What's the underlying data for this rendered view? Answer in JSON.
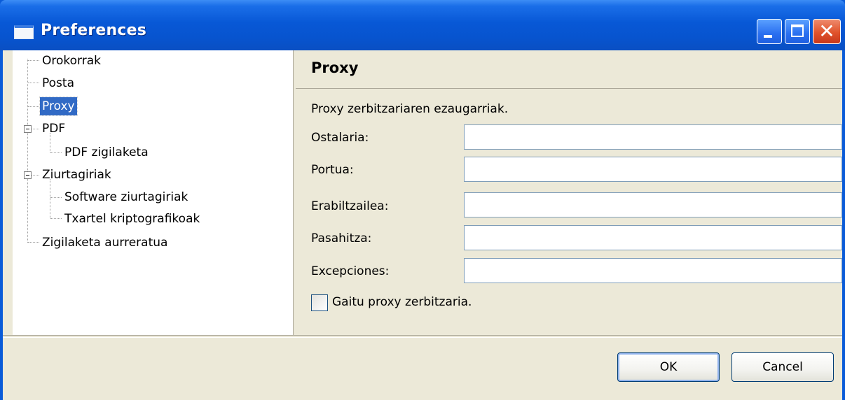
{
  "window": {
    "title": "Preferences"
  },
  "title_buttons": {
    "minimize_icon": "minimize-icon",
    "maximize_icon": "maximize-icon",
    "close_glyph": "✕"
  },
  "tree": {
    "items": [
      {
        "label": "Orokorrak"
      },
      {
        "label": "Posta"
      },
      {
        "label": "Proxy",
        "selected": true
      },
      {
        "label": "PDF",
        "expanded": true
      },
      {
        "label": "PDF zigilaketa"
      },
      {
        "label": "Ziurtagiriak",
        "expanded": true
      },
      {
        "label": "Software ziurtagiriak"
      },
      {
        "label": "Txartel kriptografikoak"
      },
      {
        "label": "Zigilaketa aurreratua"
      }
    ]
  },
  "panel": {
    "title": "Proxy",
    "description": "Proxy zerbitzariaren ezaugarriak.",
    "fields": [
      {
        "label": "Ostalaria:",
        "value": ""
      },
      {
        "label": "Portua:",
        "value": ""
      },
      {
        "label": "Erabiltzailea:",
        "value": ""
      },
      {
        "label": "Pasahitza:",
        "value": ""
      },
      {
        "label": "Excepciones:",
        "value": ""
      }
    ],
    "enable_checkbox": {
      "label": "Gaitu proxy zerbitzaria.",
      "checked": false
    }
  },
  "buttons": {
    "ok": "OK",
    "cancel": "Cancel"
  },
  "colors": {
    "titlebar": "#0858d6",
    "selection": "#316ac5",
    "dialog_bg": "#ece9d8"
  }
}
